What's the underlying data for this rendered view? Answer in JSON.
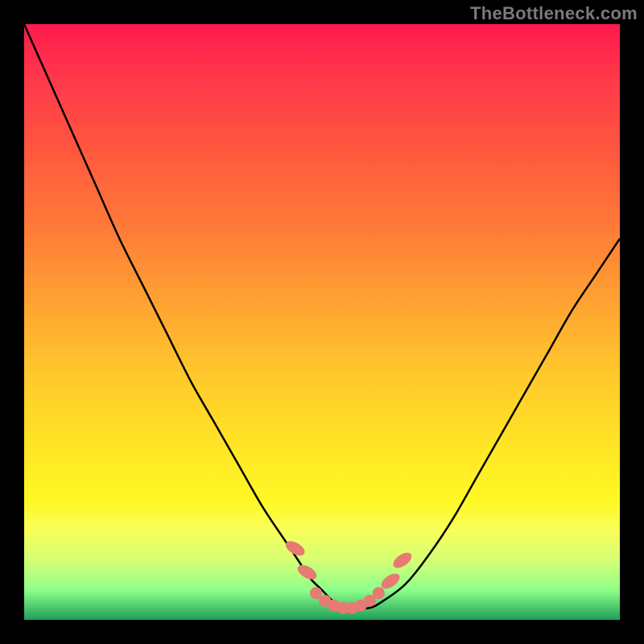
{
  "watermark": "TheBottleneck.com",
  "colors": {
    "curve": "#000000",
    "marker": "#e77a72",
    "gradient_top": "#ff1a4d",
    "gradient_bottom": "#1e9f5a"
  },
  "chart_data": {
    "type": "line",
    "title": "",
    "xlabel": "",
    "ylabel": "",
    "xlim": [
      0,
      100
    ],
    "ylim": [
      0,
      100
    ],
    "x": [
      0,
      4,
      8,
      12,
      16,
      20,
      24,
      28,
      32,
      36,
      40,
      44,
      46,
      48,
      50,
      52,
      54,
      56,
      58,
      60,
      64,
      68,
      72,
      76,
      80,
      84,
      88,
      92,
      96,
      100
    ],
    "y": [
      100,
      91,
      82,
      73,
      64,
      56,
      48,
      40,
      33,
      26,
      19,
      13,
      10,
      7,
      5,
      3,
      2,
      2,
      2,
      3,
      6,
      11,
      17,
      24,
      31,
      38,
      45,
      52,
      58,
      64
    ],
    "markers": {
      "left_ovals": [
        {
          "x": 45.5,
          "y": 12
        },
        {
          "x": 47.5,
          "y": 8
        }
      ],
      "right_ovals": [
        {
          "x": 61.5,
          "y": 6.5
        },
        {
          "x": 63.5,
          "y": 10
        }
      ],
      "bottom_beads": [
        {
          "x": 49,
          "y": 4.5
        },
        {
          "x": 50.5,
          "y": 3.2
        },
        {
          "x": 52,
          "y": 2.4
        },
        {
          "x": 53.5,
          "y": 2.0
        },
        {
          "x": 55,
          "y": 2.0
        },
        {
          "x": 56.5,
          "y": 2.4
        },
        {
          "x": 58,
          "y": 3.2
        },
        {
          "x": 59.5,
          "y": 4.5
        }
      ]
    }
  }
}
